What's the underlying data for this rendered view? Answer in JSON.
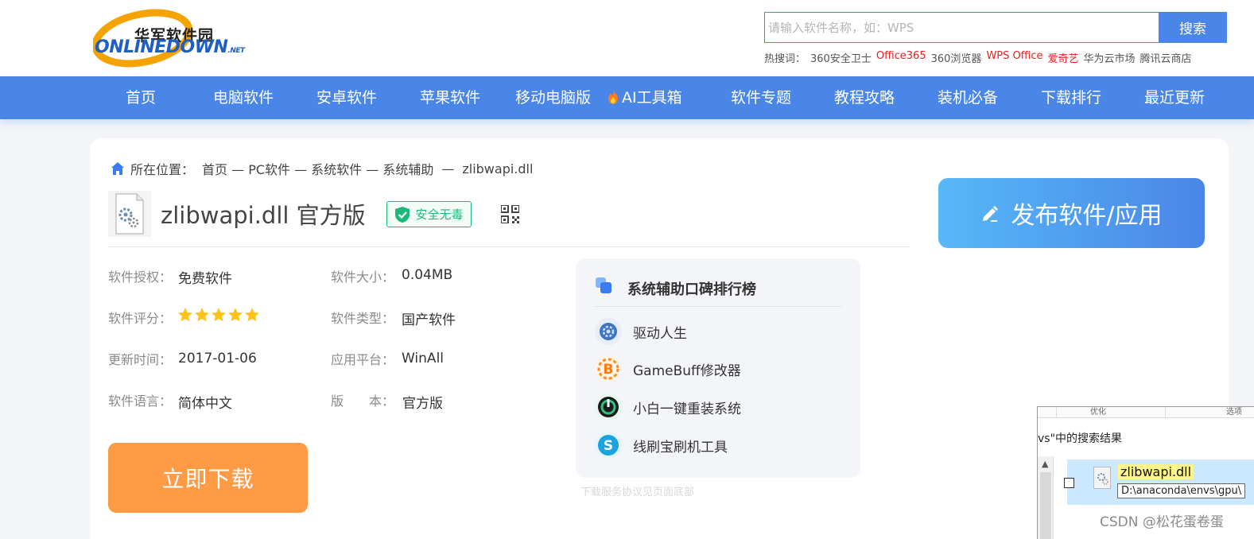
{
  "logo": {
    "cn": "华军软件园",
    "en": "ONLINEDOWN",
    "net": ".NET"
  },
  "search": {
    "placeholder": "请输入软件名称，如：WPS",
    "button": "搜索"
  },
  "hot_search": {
    "label": "热搜词：",
    "terms": [
      {
        "text": "360安全卫士",
        "color": "#555555"
      },
      {
        "text": "Office365",
        "color": "#e02222"
      },
      {
        "text": "360浏览器",
        "color": "#555555"
      },
      {
        "text": "WPS Office",
        "color": "#e02222"
      },
      {
        "text": "爱奇艺",
        "color": "#e02222"
      },
      {
        "text": "华为云市场",
        "color": "#555555"
      },
      {
        "text": "腾讯云商店",
        "color": "#555555"
      }
    ]
  },
  "nav": [
    "首页",
    "电脑软件",
    "安卓软件",
    "苹果软件",
    "移动电脑版",
    "AI工具箱",
    "软件专题",
    "教程攻略",
    "装机必备",
    "下载排行",
    "最近更新"
  ],
  "breadcrumb": {
    "label": "所在位置：",
    "path": "首页 — PC软件 — 系统软件 — 系统辅助",
    "sep": "—",
    "current": "zlibwapi.dll"
  },
  "software": {
    "title": "zlibwapi.dll  官方版",
    "safe_badge": "安全无毒",
    "info": [
      {
        "label": "软件授权：",
        "value": "免费软件"
      },
      {
        "label": "软件大小：",
        "value": "0.04MB"
      },
      {
        "label": "软件评分：",
        "value": ""
      },
      {
        "label": "软件类型：",
        "value": "国产软件"
      },
      {
        "label": "更新时间：",
        "value": "2017-01-06"
      },
      {
        "label": "应用平台：",
        "value": "WinAll"
      },
      {
        "label": "软件语言：",
        "value": "简体中文"
      },
      {
        "label": "版　　本：",
        "value": "官方版"
      }
    ],
    "rating_stars": 5,
    "download_button": "立即下载"
  },
  "rank": {
    "title": "系统辅助口碑排行榜",
    "items": [
      "驱动人生",
      "GameBuff修改器",
      "小白一键重装系统",
      "线刷宝刷机工具"
    ]
  },
  "agreement": "下载服务协议见页面底部",
  "publish_button": "发布软件/应用",
  "explorer": {
    "col_a": "优化",
    "col_b": "选项",
    "result_text": "vs\"中的搜索结果",
    "file_name": "zlibwapi.dll",
    "file_path": "D:\\anaconda\\envs\\gpu\\"
  },
  "watermark": "CSDN @松花蛋卷蛋",
  "colors": {
    "brand_blue": "#4a86e8",
    "download_orange": "#ff9a45",
    "safe_green": "#1bb87a",
    "hot_red": "#e02222"
  }
}
